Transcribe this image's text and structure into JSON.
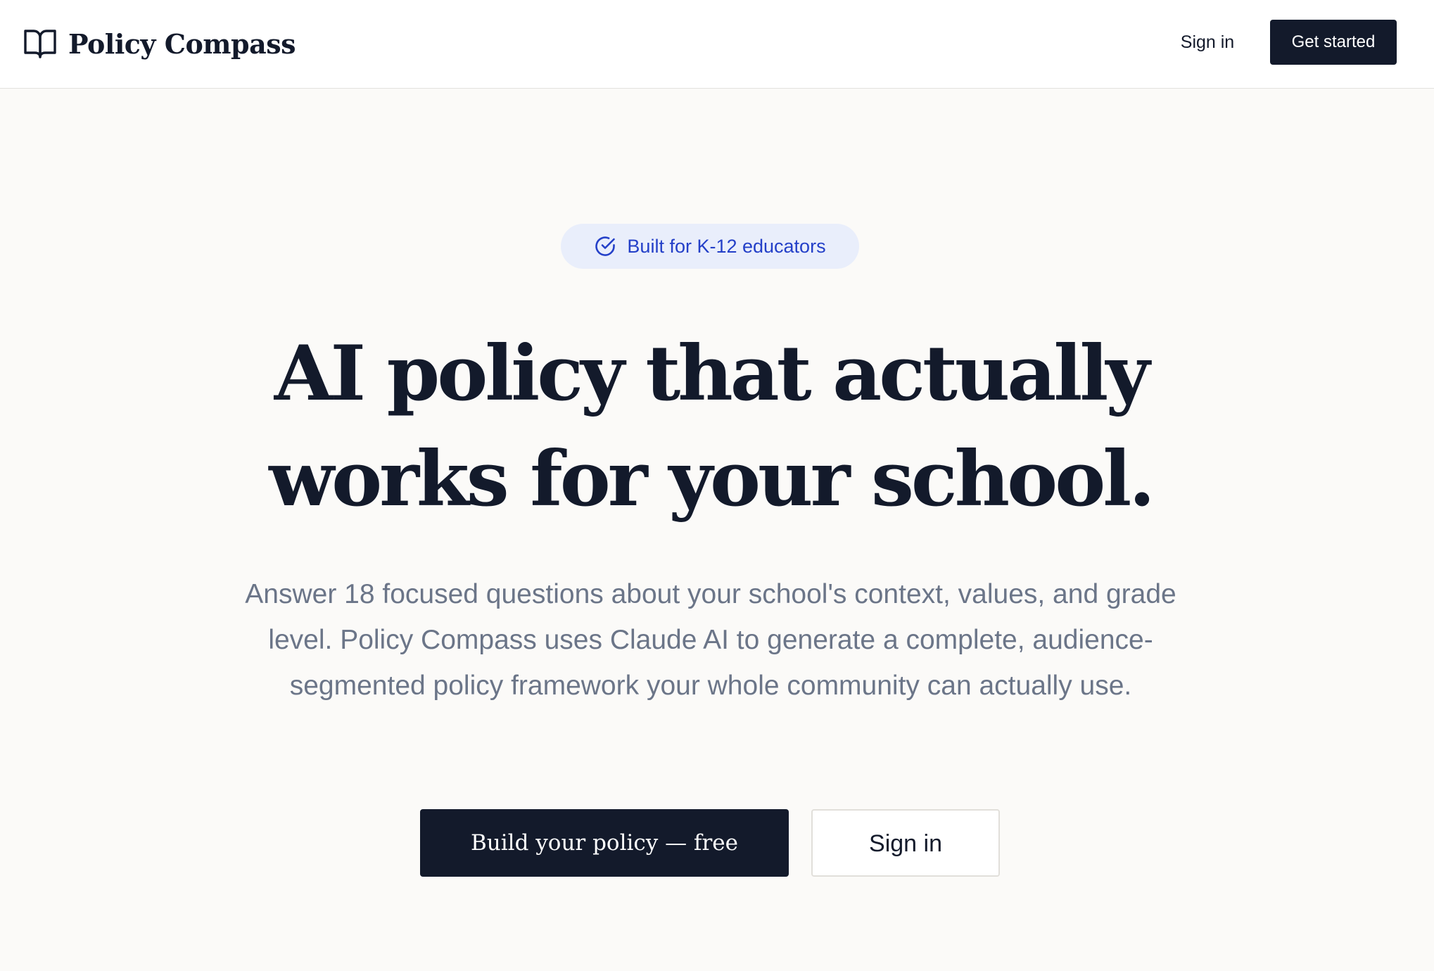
{
  "header": {
    "brand_name": "Policy Compass",
    "brand_icon": "open-book-icon",
    "signin_label": "Sign in",
    "get_started_label": "Get started"
  },
  "hero": {
    "badge_icon": "check-circle-icon",
    "badge_text": "Built for K-12 educators",
    "headline_line1": "AI policy that actually",
    "headline_line2": "works for your school.",
    "subtext": "Answer 18 focused questions about your school's context, values, and grade level. Policy Compass uses Claude AI to generate a complete, audience-segmented policy framework your whole community can actually use.",
    "primary_cta_label": "Build your policy — free",
    "secondary_cta_label": "Sign in"
  },
  "colors": {
    "ink": "#131a2b",
    "page_background": "#fbfaf8",
    "accent_blue": "#2440c8",
    "badge_background": "#e9eefb",
    "muted_text": "#6b7588"
  }
}
